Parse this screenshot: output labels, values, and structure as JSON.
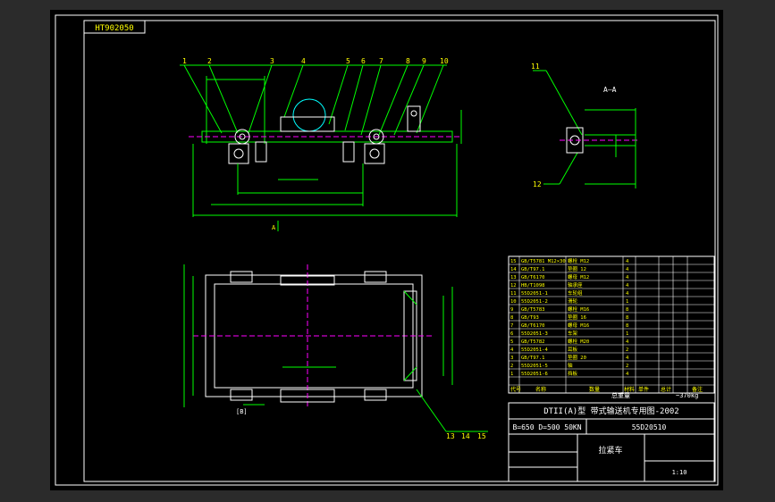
{
  "drawing": {
    "drawing_code": "HT902050",
    "section_label": "A—A",
    "section_mark": "A",
    "parts": [
      "1",
      "2",
      "3",
      "4",
      "5",
      "6",
      "7",
      "8",
      "9",
      "10",
      "11",
      "12",
      "13",
      "14",
      "15"
    ],
    "callout_view": "[B]"
  },
  "title_block": {
    "main_title": "DTII(A)型 带式输送机专用图-2002",
    "spec": "B=650 D=500 50KN",
    "drawing_number": "55D20510",
    "name": "拉紧车",
    "weight_label": "总重量",
    "weight_value": "~370kg",
    "scale": "1:10",
    "header_labels": [
      "代号",
      "名称",
      "数量",
      "材料",
      "单件",
      "总计",
      "备注"
    ],
    "bom_rows": [
      {
        "no": "15",
        "code": "GB/T5781 M12×30",
        "name": "螺栓 M12",
        "qty": "4"
      },
      {
        "no": "14",
        "code": "GB/T97.1",
        "name": "垫圈 12",
        "qty": "4"
      },
      {
        "no": "13",
        "code": "GB/T6170",
        "name": "螺母 M12",
        "qty": "4"
      },
      {
        "no": "12",
        "code": "HB/T1098",
        "name": "轴承座",
        "qty": "4"
      },
      {
        "no": "11",
        "code": "55D2051-1",
        "name": "车轮组",
        "qty": "4"
      },
      {
        "no": "10",
        "code": "55D2051-2",
        "name": "滑轮",
        "qty": "1"
      },
      {
        "no": "9",
        "code": "GB/T5783",
        "name": "螺栓 M16",
        "qty": "8"
      },
      {
        "no": "8",
        "code": "GB/T93",
        "name": "垫圈 16",
        "qty": "8"
      },
      {
        "no": "7",
        "code": "GB/T6170",
        "name": "螺母 M16",
        "qty": "8"
      },
      {
        "no": "6",
        "code": "55D2051-3",
        "name": "车架",
        "qty": "1"
      },
      {
        "no": "5",
        "code": "GB/T5782",
        "name": "螺栓 M20",
        "qty": "4"
      },
      {
        "no": "4",
        "code": "55D2051-4",
        "name": "耳板",
        "qty": "2"
      },
      {
        "no": "3",
        "code": "GB/T97.1",
        "name": "垫圈 20",
        "qty": "4"
      },
      {
        "no": "2",
        "code": "55D2051-5",
        "name": "轴",
        "qty": "2"
      },
      {
        "no": "1",
        "code": "55D2051-6",
        "name": "挡板",
        "qty": "4"
      }
    ]
  },
  "colors": {
    "background": "#000000",
    "frame": "#ffffff",
    "geometry": "#00ff00",
    "centerline": "#ff00ff",
    "text": "#ffff00",
    "detail": "#00ffff"
  }
}
